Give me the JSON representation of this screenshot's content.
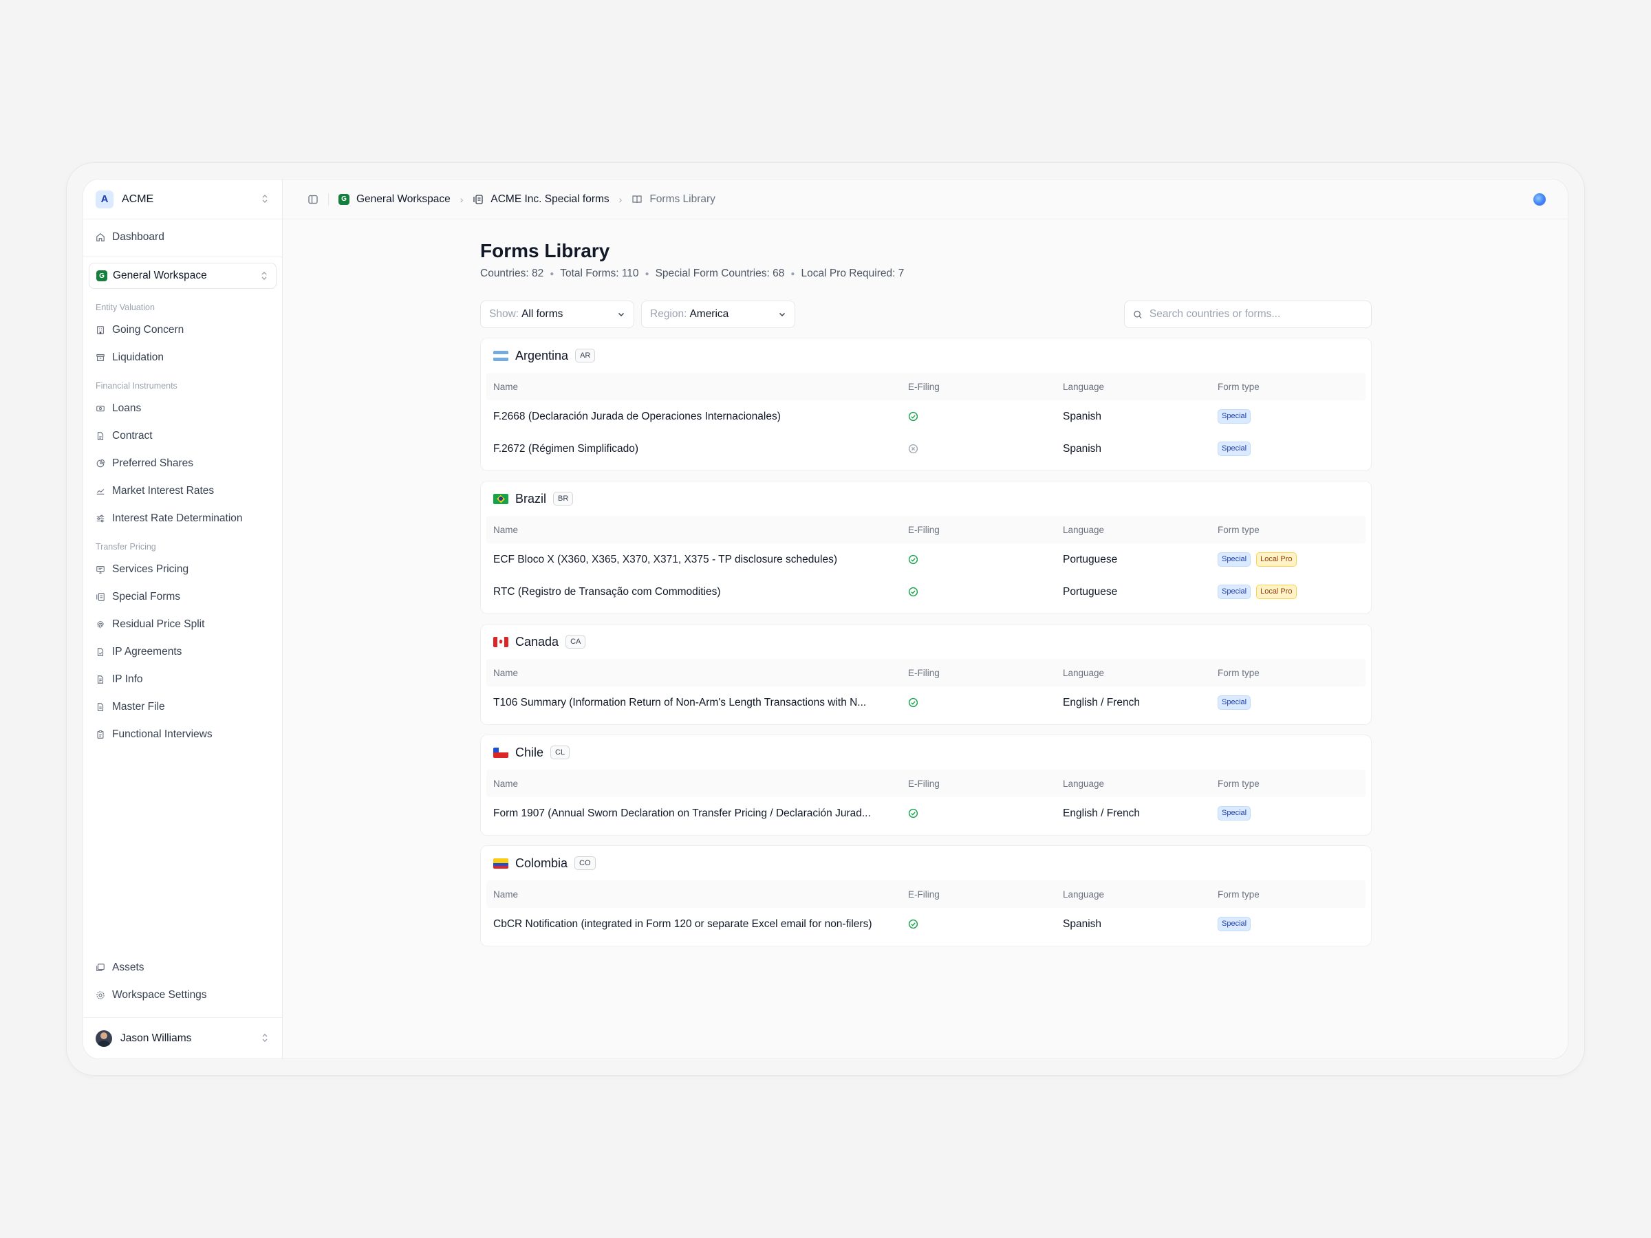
{
  "org": {
    "avatar": "A",
    "name": "ACME"
  },
  "sidebar": {
    "dashboard": "Dashboard",
    "workspace": {
      "badge": "G",
      "name": "General Workspace"
    },
    "sections": [
      {
        "label": "Entity Valuation",
        "items": [
          {
            "label": "Going Concern",
            "icon": "building-icon"
          },
          {
            "label": "Liquidation",
            "icon": "archive-icon"
          }
        ]
      },
      {
        "label": "Financial Instruments",
        "items": [
          {
            "label": "Loans",
            "icon": "banknote-icon"
          },
          {
            "label": "Contract",
            "icon": "file-icon"
          },
          {
            "label": "Preferred Shares",
            "icon": "pie-chart-icon"
          },
          {
            "label": "Market Interest Rates",
            "icon": "trend-chart-icon"
          },
          {
            "label": "Interest Rate Determination",
            "icon": "sliders-icon"
          }
        ]
      },
      {
        "label": "Transfer Pricing",
        "items": [
          {
            "label": "Services Pricing",
            "icon": "monitor-icon"
          },
          {
            "label": "Special Forms",
            "icon": "forms-icon"
          },
          {
            "label": "Residual Price Split",
            "icon": "fingerprint-icon"
          },
          {
            "label": "IP Agreements",
            "icon": "file-check-icon"
          },
          {
            "label": "IP Info",
            "icon": "file-info-icon"
          },
          {
            "label": "Master File",
            "icon": "file-text-icon"
          },
          {
            "label": "Functional Interviews",
            "icon": "clipboard-icon"
          }
        ]
      }
    ],
    "bottom": {
      "assets": "Assets",
      "settings": "Workspace Settings"
    },
    "user": {
      "name": "Jason Williams"
    }
  },
  "breadcrumb": {
    "workspace_badge": "G",
    "workspace": "General Workspace",
    "project": "ACME Inc. Special forms",
    "current": "Forms Library"
  },
  "page": {
    "title": "Forms Library",
    "stats": [
      "Countries: 82",
      "Total Forms: 110",
      "Special Form Countries: 68",
      "Local Pro Required: 7"
    ]
  },
  "filters": {
    "show_label": "Show:",
    "show_value": "All forms",
    "region_label": "Region:",
    "region_value": "America",
    "search_placeholder": "Search countries or forms..."
  },
  "table_headers": {
    "name": "Name",
    "efiling": "E-Filing",
    "language": "Language",
    "form_type": "Form type"
  },
  "countries": [
    {
      "name": "Argentina",
      "code": "AR",
      "forms": [
        {
          "name": "F.2668 (Declaración Jurada de Operaciones Internacionales)",
          "efiling": true,
          "language": "Spanish",
          "types": [
            "Special"
          ]
        },
        {
          "name": "F.2672 (Régimen Simplificado)",
          "efiling": false,
          "language": "Spanish",
          "types": [
            "Special"
          ]
        }
      ]
    },
    {
      "name": "Brazil",
      "code": "BR",
      "forms": [
        {
          "name": "ECF Bloco X (X360, X365, X370, X371, X375 - TP disclosure schedules)",
          "efiling": true,
          "language": "Portuguese",
          "types": [
            "Special",
            "Local Pro"
          ]
        },
        {
          "name": "RTC (Registro de Transação com Commodities)",
          "efiling": true,
          "language": "Portuguese",
          "types": [
            "Special",
            "Local Pro"
          ]
        }
      ]
    },
    {
      "name": "Canada",
      "code": "CA",
      "forms": [
        {
          "name": "T106 Summary (Information Return of Non-Arm's Length Transactions with N...",
          "efiling": true,
          "language": "English / French",
          "types": [
            "Special"
          ]
        }
      ]
    },
    {
      "name": "Chile",
      "code": "CL",
      "forms": [
        {
          "name": "Form 1907 (Annual Sworn Declaration on Transfer Pricing / Declaración Jurad...",
          "efiling": true,
          "language": "English / French",
          "types": [
            "Special"
          ]
        }
      ]
    },
    {
      "name": "Colombia",
      "code": "CO",
      "forms": [
        {
          "name": "CbCR Notification (integrated in Form 120 or separate Excel email for non-filers)",
          "efiling": true,
          "language": "Spanish",
          "types": [
            "Special"
          ]
        }
      ]
    }
  ],
  "colors": {
    "success": "#16a34a",
    "muted": "#9ca3af",
    "special_bg": "#dbeafe",
    "special_fg": "#1e40af",
    "local_bg": "#fef3c7",
    "local_fg": "#92400e",
    "workspace_green": "#15803d"
  }
}
